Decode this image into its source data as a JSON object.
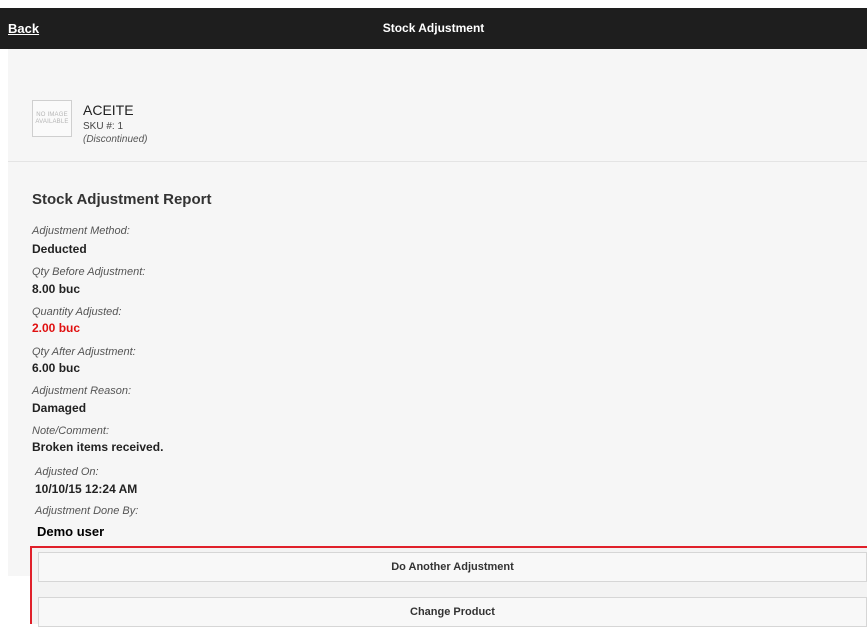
{
  "header": {
    "back_label": "Back",
    "title": "Stock Adjustment"
  },
  "product": {
    "image_placeholder": "NO IMAGE AVAILABLE",
    "name": "ACEITE",
    "sku": "SKU #: 1",
    "status": "(Discontinued)"
  },
  "report": {
    "title": "Stock Adjustment Report",
    "fields": [
      {
        "label": "Adjustment Method:",
        "value": "Deducted"
      },
      {
        "label": "Qty Before Adjustment:",
        "value": "8.00 buc"
      },
      {
        "label": "Quantity Adjusted:",
        "value": "2.00 buc"
      },
      {
        "label": "Qty After Adjustment:",
        "value": "6.00 buc"
      },
      {
        "label": "Adjustment Reason:",
        "value": "Damaged"
      },
      {
        "label": "Note/Comment:",
        "value": "Broken items received."
      },
      {
        "label": "Adjusted On:",
        "value": "10/10/15 12:24 AM"
      },
      {
        "label": "Adjustment Done By:",
        "value": "Demo user"
      }
    ]
  },
  "actions": {
    "another_label": "Do Another Adjustment",
    "change_label": "Change Product"
  },
  "colors": {
    "header_bg": "#1e1e1e",
    "highlight_value": "#e01010",
    "annotation_border": "#e0202a"
  }
}
